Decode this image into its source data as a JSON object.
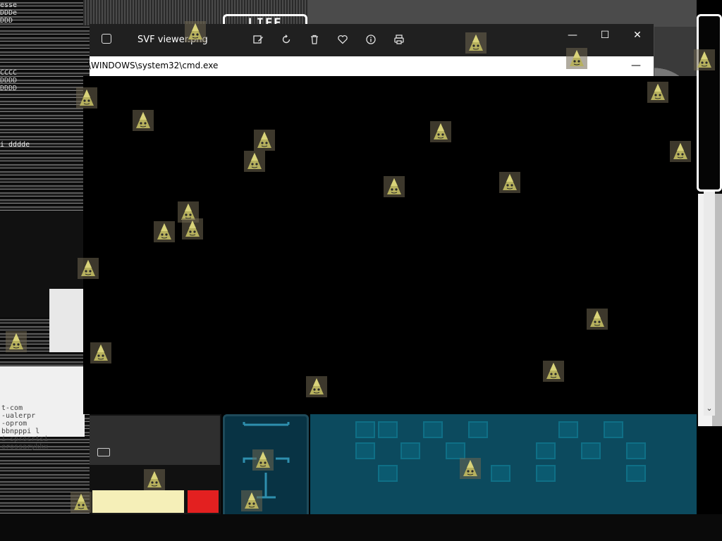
{
  "background_game": {
    "life_label": "LIFE"
  },
  "viewer": {
    "title": "SVF viewer.png",
    "toolbar": {
      "edit_icon": "edit-image-icon",
      "rotate_icon": "rotate-icon",
      "delete_icon": "delete-icon",
      "favorite_icon": "heart-icon",
      "info_icon": "info-icon",
      "print_icon": "print-icon"
    },
    "window_buttons": {
      "minimize": "—",
      "maximize": "☐",
      "close": "✕"
    }
  },
  "cmd": {
    "title": "\\WINDOWS\\system32\\cmd.exe",
    "minimize": "—",
    "scroll_down": "⌄"
  },
  "glitch_text": {
    "left_top": "esse\nDDDe\nDDD",
    "left_mid": "CCCC\nDDDD\nDDDD",
    "left_low": "i dddde",
    "bottom_text": "t-com\n-ualerpr\n-oprom\nbbnpppi l\ni-sprocrtsi\nerossarykkx"
  },
  "colors": {
    "tile_bg": "#0c4a5e",
    "tile_border": "#0f6f86",
    "life_red": "#e32020",
    "life_yellow": "#f5efb8"
  }
}
